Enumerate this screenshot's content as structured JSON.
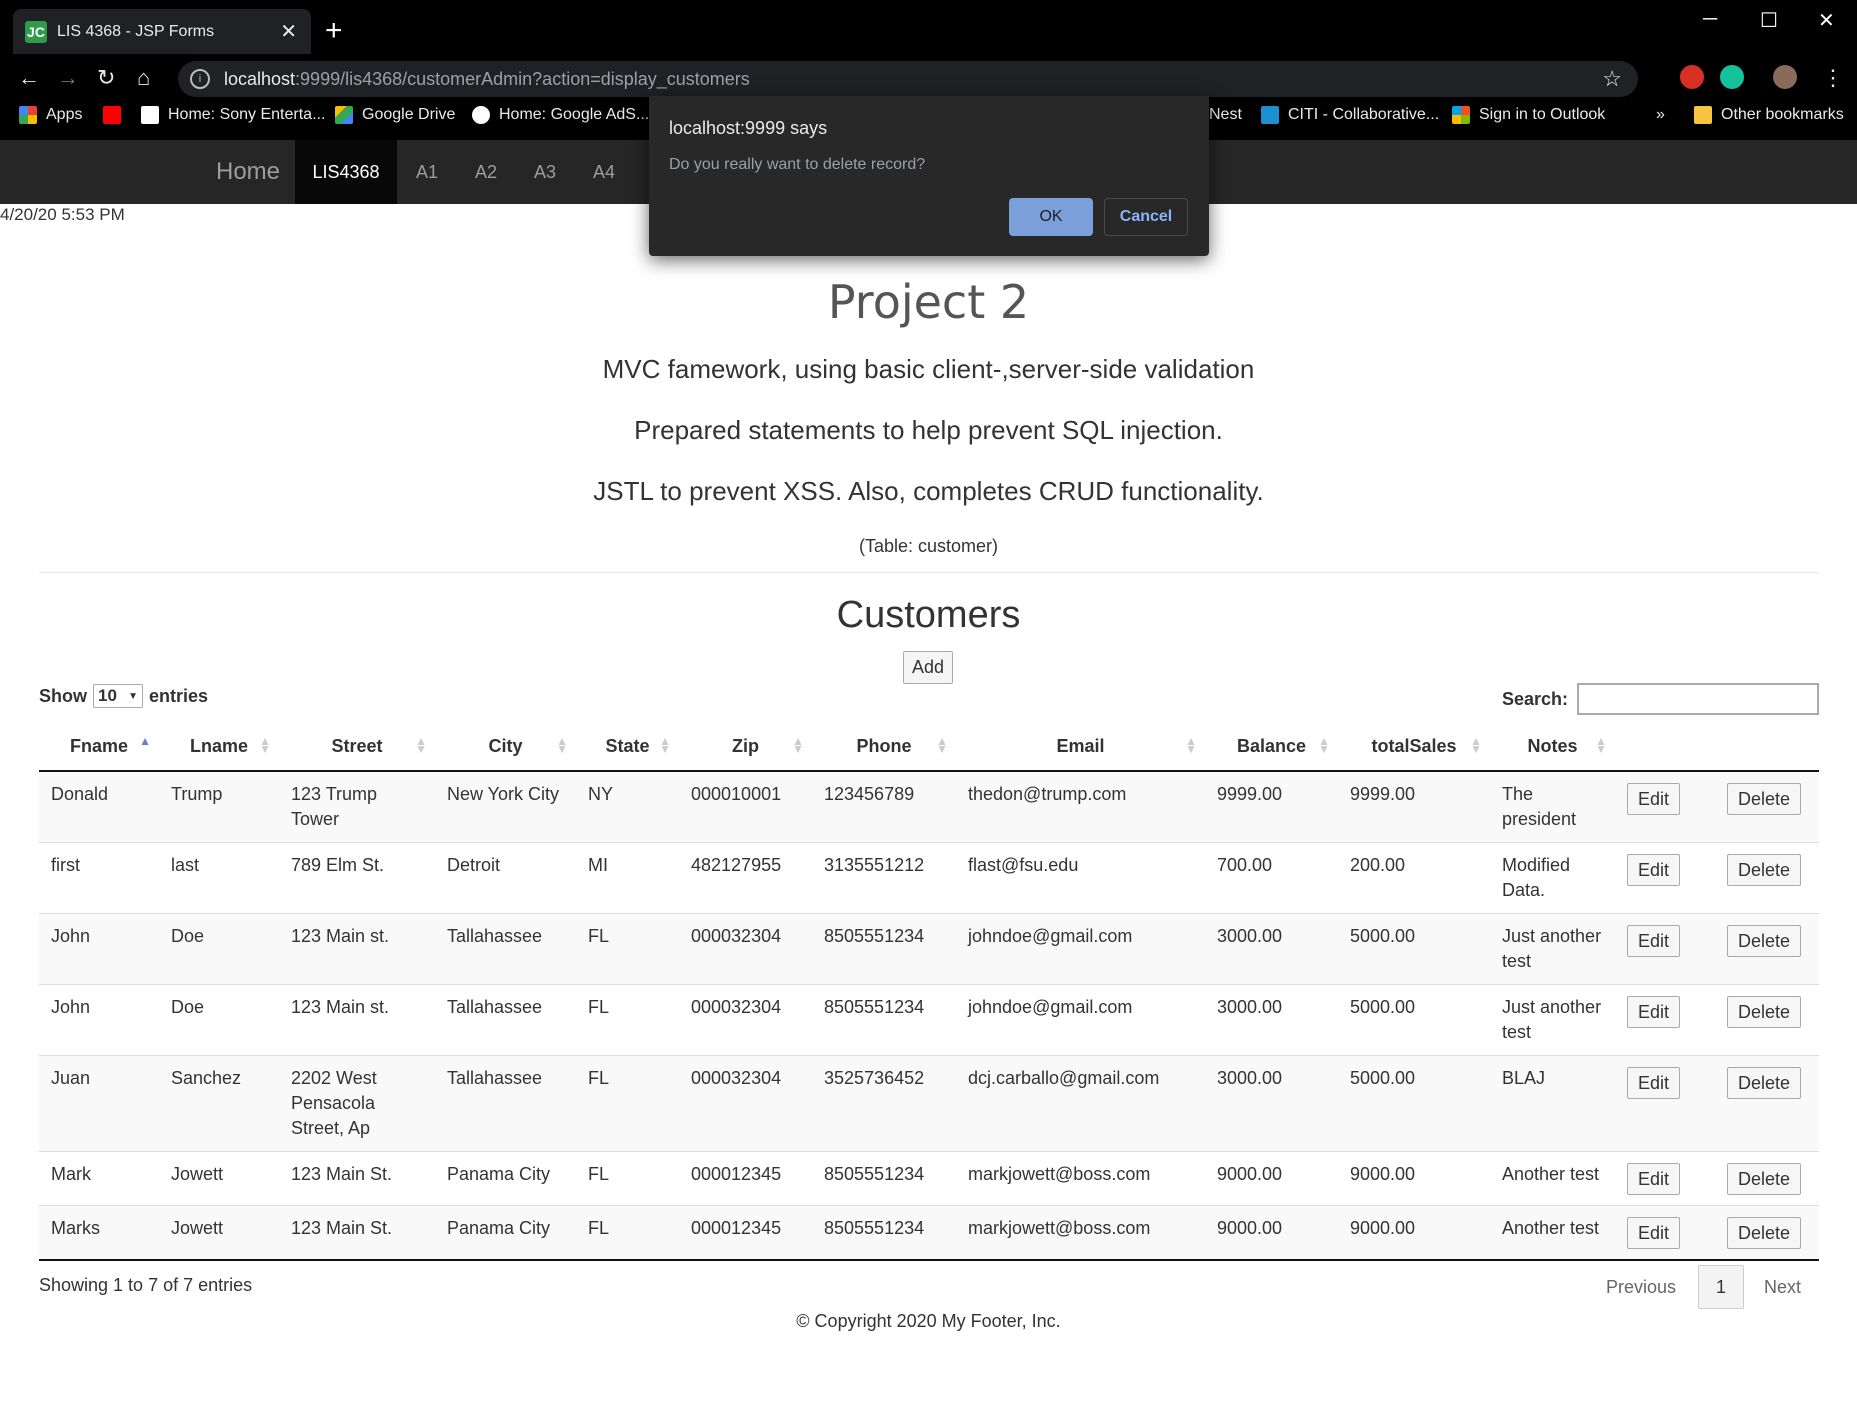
{
  "browser": {
    "tab_title": "LIS 4368 - JSP Forms",
    "favicon_text": "JC",
    "url_host": "localhost",
    "url_rest": ":9999/lis4368/customerAdmin?action=display_customers",
    "bookmarks": [
      {
        "label": "Apps",
        "icon": "apps-grid-icon"
      },
      {
        "label": "",
        "icon": "youtube-icon"
      },
      {
        "label": "Home: Sony Enterta...",
        "icon": "sony-s-icon"
      },
      {
        "label": "Google Drive",
        "icon": "google-drive-icon"
      },
      {
        "label": "Home: Google AdS...",
        "icon": "google-g-icon"
      },
      {
        "label": "Nest",
        "icon": ""
      },
      {
        "label": "CITI - Collaborative...",
        "icon": "citi-c-icon"
      },
      {
        "label": "Sign in to Outlook",
        "icon": "microsoft-icon"
      },
      {
        "label": "»",
        "icon": ""
      },
      {
        "label": "Other bookmarks",
        "icon": "folder-icon"
      }
    ]
  },
  "navbar": {
    "brand": "Home",
    "items": [
      "LIS4368",
      "A1",
      "A2",
      "A3",
      "A4"
    ],
    "active": "LIS4368"
  },
  "datetime": "4/20/20 5:53 PM",
  "header": {
    "title": "Project 2",
    "lines": [
      "MVC famework, using basic client-,server-side validation",
      "Prepared statements to help prevent SQL injection.",
      "JSTL to prevent XSS. Also, completes CRUD functionality."
    ],
    "table_note": "(Table: customer)"
  },
  "customers": {
    "heading": "Customers",
    "add_label": "Add",
    "show_label": "Show",
    "entries_label": "entries",
    "page_length": "10",
    "search_label": "Search:",
    "search_value": "",
    "columns": [
      "Fname",
      "Lname",
      "Street",
      "City",
      "State",
      "Zip",
      "Phone",
      "Email",
      "Balance",
      "totalSales",
      "Notes"
    ],
    "edit_label": "Edit",
    "delete_label": "Delete",
    "rows": [
      [
        "Donald",
        "Trump",
        "123 Trump Tower",
        "New York City",
        "NY",
        "000010001",
        "123456789",
        "thedon@trump.com",
        "9999.00",
        "9999.00",
        "The president"
      ],
      [
        "first",
        "last",
        "789 Elm St.",
        "Detroit",
        "MI",
        "482127955",
        "3135551212",
        "flast@fsu.edu",
        "700.00",
        "200.00",
        "Modified Data."
      ],
      [
        "John",
        "Doe",
        "123 Main st.",
        "Tallahassee",
        "FL",
        "000032304",
        "8505551234",
        "johndoe@gmail.com",
        "3000.00",
        "5000.00",
        "Just another test"
      ],
      [
        "John",
        "Doe",
        "123 Main st.",
        "Tallahassee",
        "FL",
        "000032304",
        "8505551234",
        "johndoe@gmail.com",
        "3000.00",
        "5000.00",
        "Just another test"
      ],
      [
        "Juan",
        "Sanchez",
        "2202 West Pensacola Street, Ap",
        "Tallahassee",
        "FL",
        "000032304",
        "3525736452",
        "dcj.carballo@gmail.com",
        "3000.00",
        "5000.00",
        "BLAJ"
      ],
      [
        "Mark",
        "Jowett",
        "123 Main St.",
        "Panama City",
        "FL",
        "000012345",
        "8505551234",
        "markjowett@boss.com",
        "9000.00",
        "9000.00",
        "Another test"
      ],
      [
        "Marks",
        "Jowett",
        "123 Main St.",
        "Panama City",
        "FL",
        "000012345",
        "8505551234",
        "markjowett@boss.com",
        "9000.00",
        "9000.00",
        "Another test"
      ]
    ],
    "info": "Showing 1 to 7 of 7 entries",
    "pager": {
      "previous": "Previous",
      "current": "1",
      "next": "Next"
    }
  },
  "footer": "© Copyright 2020 My Footer, Inc.",
  "dialog": {
    "title": "localhost:9999 says",
    "message": "Do you really want to delete record?",
    "ok": "OK",
    "cancel": "Cancel"
  },
  "colors": {
    "navbar_bg": "#262626",
    "navbar_active": "#080808",
    "dialog_bg": "#282828",
    "ok_button": "#7b9fd8",
    "sort_active": "#6b7bd9"
  }
}
